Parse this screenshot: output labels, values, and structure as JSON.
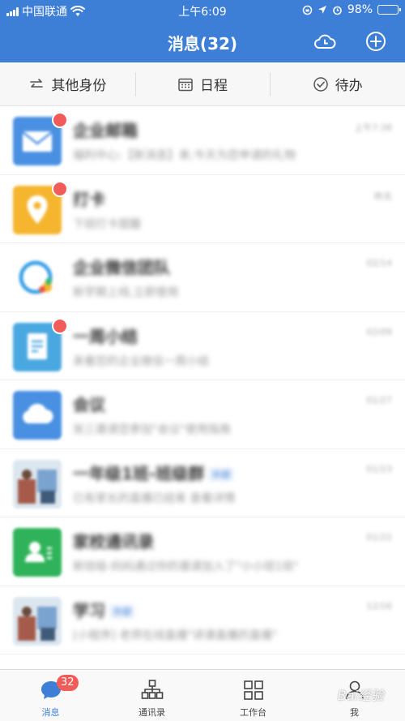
{
  "status_bar": {
    "carrier": "中国联通",
    "time": "上午6:09",
    "battery": "98%",
    "battery_level": 0.98
  },
  "header": {
    "title": "消息(32)",
    "left_action_icon": "cloud-clock-icon",
    "right_action_icon": "plus-circle-icon"
  },
  "quick_tabs": [
    {
      "label": "其他身份",
      "icon": "switch-arrows-icon"
    },
    {
      "label": "日程",
      "icon": "calendar-icon"
    },
    {
      "label": "待办",
      "icon": "check-circle-icon"
    }
  ],
  "messages": [
    {
      "title": "企业邮箱",
      "subtitle": "福利中心:【新消息】来,今天为您申请的礼物",
      "time": "上午7:38",
      "tag": "",
      "avatar_color": "#4a90e2",
      "avatar_icon": "mail-icon",
      "badge": true
    },
    {
      "title": "打卡",
      "subtitle": "下班打卡提醒",
      "time": "昨天",
      "tag": "",
      "avatar_color": "#f5b52e",
      "avatar_icon": "location-pin-icon",
      "badge": true
    },
    {
      "title": "企业微信团队",
      "subtitle": "新学期上线,立即使用",
      "time": "02/14",
      "tag": "",
      "avatar_color": "#ffffff",
      "avatar_icon": "chat-bubbles-icon",
      "badge": false
    },
    {
      "title": "一周小结",
      "subtitle": "来看您的企业微信一周小结",
      "time": "02/09",
      "tag": "",
      "avatar_color": "#4aa8e0",
      "avatar_icon": "document-icon",
      "badge": true
    },
    {
      "title": "会议",
      "subtitle": "张三邀请您参加\"会议\"使用指南",
      "time": "01/27",
      "tag": "",
      "avatar_color": "#4a90e2",
      "avatar_icon": "cloud-icon",
      "badge": false
    },
    {
      "title": "一年级1班-班级群",
      "subtitle": "已有家长的直播已结束 查看详情",
      "time": "01/23",
      "tag": "外部",
      "avatar_color": "#c9d6e3",
      "avatar_icon": "photo-icon",
      "badge": false
    },
    {
      "title": "家校通讯录",
      "subtitle": "新班级-妈妈通过你的邀请加入了\"小小班1班\"",
      "time": "01/22",
      "tag": "",
      "avatar_color": "#2fb35a",
      "avatar_icon": "contact-card-icon",
      "badge": false
    },
    {
      "title": "学习",
      "subtitle": "[小程序] 老师在线直播\"讲课直播的直播\"",
      "time": "12/16",
      "tag": "外部",
      "avatar_color": "#c9d6e3",
      "avatar_icon": "photo-icon",
      "badge": false
    }
  ],
  "bottom_nav": [
    {
      "label": "消息",
      "icon": "chat-bubble-icon",
      "active": true,
      "badge": "32"
    },
    {
      "label": "通讯录",
      "icon": "org-chart-icon",
      "active": false,
      "badge": ""
    },
    {
      "label": "工作台",
      "icon": "grid-icon",
      "active": false,
      "badge": ""
    },
    {
      "label": "我",
      "icon": "person-icon",
      "active": false,
      "badge": ""
    }
  ],
  "watermark": "Bai经验",
  "colors": {
    "brand": "#3d7fd6",
    "badge": "#f25c58"
  }
}
